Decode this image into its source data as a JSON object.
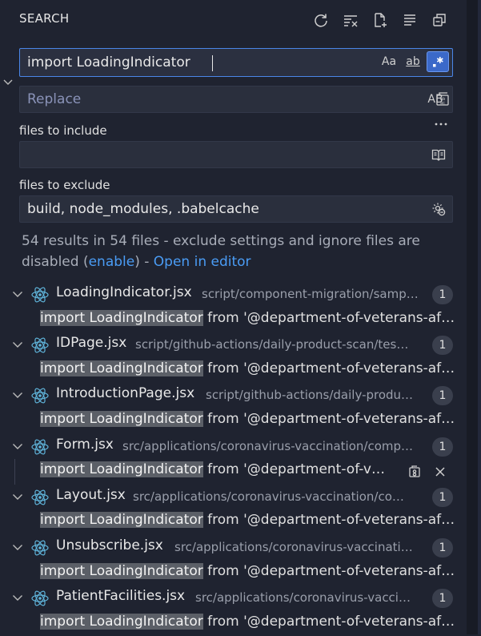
{
  "header": {
    "title": "SEARCH"
  },
  "toolbar": {
    "icons": [
      "refresh-icon",
      "clear-results-icon",
      "new-search-editor-icon",
      "view-as-tree-icon",
      "collapse-all-icon"
    ]
  },
  "search": {
    "value": "import LoadingIndicator",
    "options": {
      "match_case": "Aa",
      "whole_word": "ab",
      "regex_active": true
    }
  },
  "replace": {
    "placeholder": "Replace",
    "preserve_case": "AB"
  },
  "include": {
    "label": "files to include",
    "value": ""
  },
  "exclude": {
    "label": "files to exclude",
    "value": "build, node_modules, .babelcache"
  },
  "summary": {
    "text_before": "54 results in 54 files - exclude settings and ignore files are disabled (",
    "enable_link": "enable",
    "text_mid": ") - ",
    "open_editor_link": "Open in editor"
  },
  "colors": {
    "accent": "#3b69c9",
    "link": "#4a9cf5",
    "react": "#5fb3d9",
    "badge_bg": "#3a3f4d",
    "highlight": "#5b5f67"
  },
  "results": [
    {
      "file": "LoadingIndicator.jsx",
      "path": "script/component-migration/samp…",
      "count": "1",
      "match_hl": "import LoadingIndicator",
      "match_rest": " from '@department-of-veterans-af…"
    },
    {
      "file": "IDPage.jsx",
      "path": "script/github-actions/daily-product-scan/tes…",
      "count": "1",
      "match_hl": "import LoadingIndicator",
      "match_rest": " from '@department-of-veterans-af…"
    },
    {
      "file": "IntroductionPage.jsx",
      "path": "script/github-actions/daily-produ…",
      "count": "1",
      "match_hl": "import LoadingIndicator",
      "match_rest": " from '@department-of-veterans-af…"
    },
    {
      "file": "Form.jsx",
      "path": "src/applications/coronavirus-vaccination/comp…",
      "count": "1",
      "match_hl": "import LoadingIndicator",
      "match_rest": " from '@department-of-v…",
      "hovered": true
    },
    {
      "file": "Layout.jsx",
      "path": "src/applications/coronavirus-vaccination/co…",
      "count": "1",
      "match_hl": "import LoadingIndicator",
      "match_rest": " from '@department-of-veterans-af…"
    },
    {
      "file": "Unsubscribe.jsx",
      "path": "src/applications/coronavirus-vaccinati…",
      "count": "1",
      "match_hl": "import LoadingIndicator",
      "match_rest": " from '@department-of-veterans-af…"
    },
    {
      "file": "PatientFacilities.jsx",
      "path": "src/applications/coronavirus-vacci…",
      "count": "1",
      "match_hl": "import LoadingIndicator",
      "match_rest": " from '@department-of-veterans-af…"
    }
  ]
}
